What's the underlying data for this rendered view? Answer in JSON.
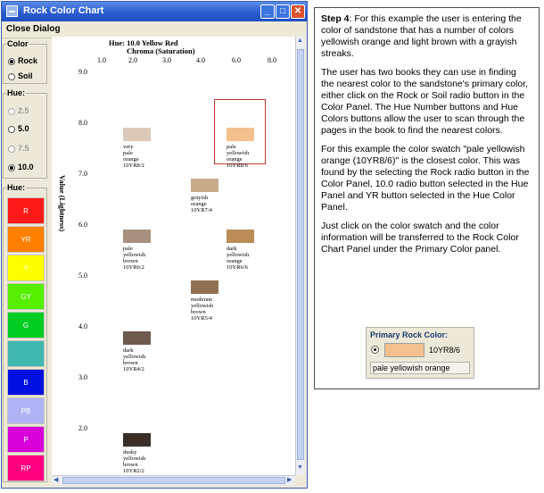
{
  "window": {
    "title": "Rock Color Chart",
    "menu": "Close Dialog"
  },
  "color_panel": {
    "title": "Color",
    "options": [
      {
        "label": "Rock",
        "selected": true
      },
      {
        "label": "Soil",
        "selected": false
      }
    ]
  },
  "hue_panel": {
    "title": "Hue:",
    "options": [
      {
        "label": "2.5",
        "selected": false,
        "enabled": false
      },
      {
        "label": "5.0",
        "selected": false,
        "enabled": true
      },
      {
        "label": "7.5",
        "selected": false,
        "enabled": false
      },
      {
        "label": "10.0",
        "selected": true,
        "enabled": true
      }
    ]
  },
  "hue_colors": {
    "title": "Hue:",
    "buttons": [
      {
        "label": "R",
        "color": "#ff1a1a"
      },
      {
        "label": "YR",
        "color": "#ff7f00"
      },
      {
        "label": "Y",
        "color": "#ffff00"
      },
      {
        "label": "GY",
        "color": "#55ee00"
      },
      {
        "label": "G",
        "color": "#00cc22"
      },
      {
        "label": "",
        "color": "#40b8b0"
      },
      {
        "label": "B",
        "color": "#0010e0"
      },
      {
        "label": "PB",
        "color": "#b0b4f6"
      },
      {
        "label": "P",
        "color": "#d800d8"
      },
      {
        "label": "RP",
        "color": "#ff0080"
      }
    ]
  },
  "chart": {
    "hue_title": "Hue: 10.0 Yellow Red",
    "chroma_title": "Chroma (Saturation)",
    "value_title": "Value (Lightness)",
    "chroma_ticks": [
      "1.0",
      "2.0",
      "3.0",
      "4.0",
      "6.0",
      "8.0"
    ],
    "value_ticks": [
      "9.0",
      "8.0",
      "7.0",
      "6.0",
      "5.0",
      "4.0",
      "3.0",
      "2.0"
    ],
    "swatches": [
      {
        "chroma": 2,
        "value": 8,
        "color": "#dcc8b8",
        "lines": [
          "very",
          "pale",
          "orange",
          "10YR8/2"
        ]
      },
      {
        "chroma": 6,
        "value": 8,
        "color": "#f4c08e",
        "lines": [
          "pale",
          "yellowish",
          "orange",
          "10YR8/6"
        ],
        "selected": true
      },
      {
        "chroma": 4,
        "value": 7,
        "color": "#c8a98a",
        "lines": [
          "grayish",
          "orange",
          "10YR7/4"
        ]
      },
      {
        "chroma": 2,
        "value": 6,
        "color": "#a89080",
        "lines": [
          "pale",
          "yellowish",
          "brown",
          "10YR6/2"
        ]
      },
      {
        "chroma": 6,
        "value": 6,
        "color": "#ba8c58",
        "lines": [
          "dark",
          "yellowish",
          "orange",
          "10YR6/6"
        ]
      },
      {
        "chroma": 4,
        "value": 5,
        "color": "#927052",
        "lines": [
          "moderate",
          "yellowish",
          "brown",
          "10YR5/4"
        ]
      },
      {
        "chroma": 2,
        "value": 4,
        "color": "#6e5a4e",
        "lines": [
          "dark",
          "yellowish",
          "brown",
          "10YR4/2"
        ]
      },
      {
        "chroma": 2,
        "value": 2,
        "color": "#3a2e26",
        "lines": [
          "dusky",
          "yellowish",
          "brown",
          "10YR2/2"
        ]
      }
    ]
  },
  "instructions": {
    "step_label": "Step 4",
    "p1": ":  For this example the user is entering the color of sandstone that has a number of colors yellowish orange and light brown with a grayish streaks.",
    "p2": "The user has two books they can use in finding the nearest color to the sandstone's primary color, either click on the Rock or Soil radio button in the Color Panel. The Hue Number buttons and Hue Colors buttons allow the user to scan through the pages in the book to find the nearest colors.",
    "p3": "For this example the color swatch \"pale yellowish orange (10YR8/6)\" is the closest color. This was found by the selecting the Rock radio button in the Color Panel, 10.0 radio button selected in the Hue Panel and YR button selected in the Hue Color Panel.",
    "p4": "Just click on the color swatch and the color information will be transferred to the Rock Color Chart Panel under the Primary Color panel."
  },
  "primary_rock_color": {
    "title": "Primary Rock Color:",
    "code": "10YR8/6",
    "name": "pale yellowish orange",
    "color": "#f4c08e"
  }
}
